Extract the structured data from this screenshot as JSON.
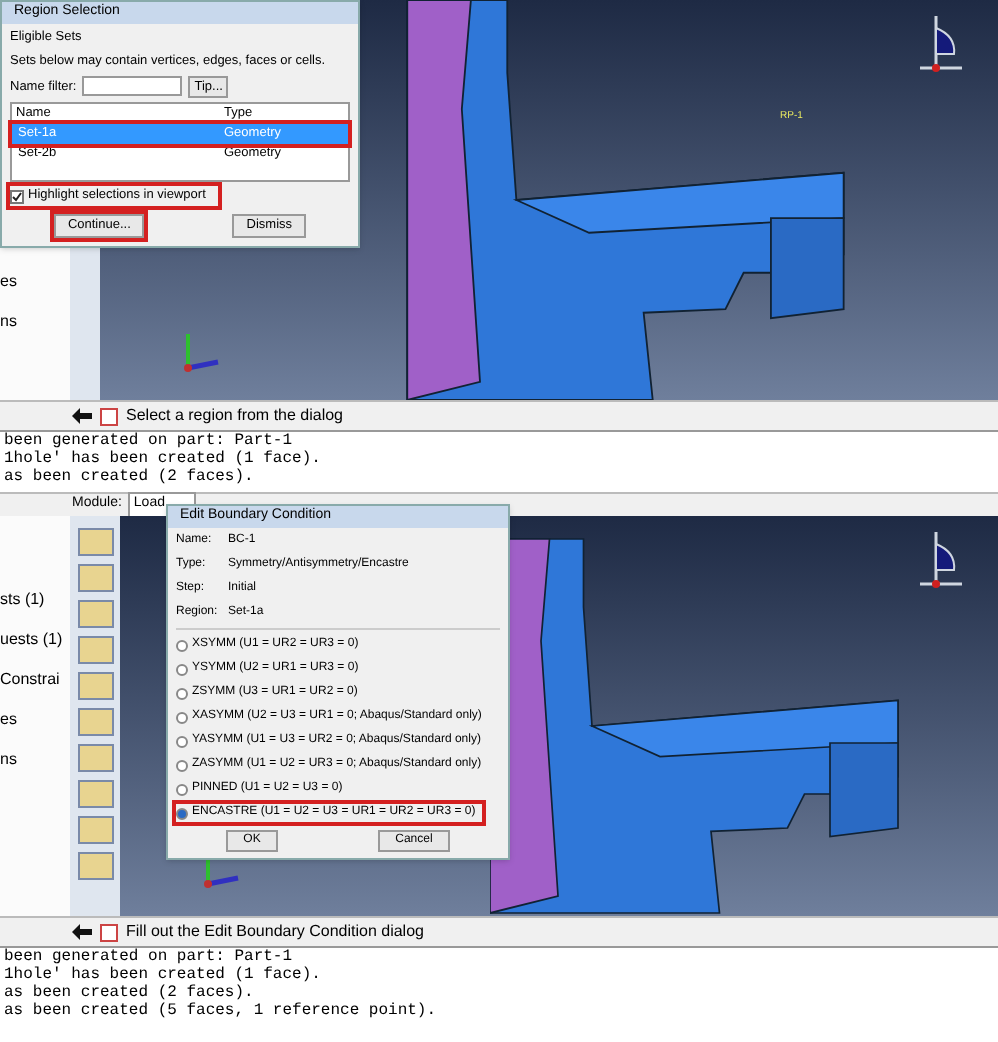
{
  "top_screen": {
    "tree_items": [
      "es",
      "ns"
    ],
    "region_dialog": {
      "title": "Region Selection",
      "section": "Eligible Sets",
      "description": "Sets below may contain vertices, edges, faces or cells.",
      "filter_label": "Name filter:",
      "tip_button": "Tip...",
      "columns": [
        "Name",
        "Type"
      ],
      "rows": [
        {
          "name": "Set-1a",
          "type": "Geometry",
          "selected": true,
          "highlighted": true
        },
        {
          "name": "Set-2b",
          "type": "Geometry",
          "selected": false,
          "highlighted": false
        }
      ],
      "highlight_checkbox": {
        "label": "Highlight selections in viewport",
        "checked": true,
        "highlighted": true
      },
      "buttons": [
        {
          "label": "Continue...",
          "highlighted": true
        },
        {
          "label": "Dismiss",
          "highlighted": false
        }
      ]
    },
    "rp_label": "RP-1",
    "prompt": "Select a region from the dialog",
    "messages": [
      "been generated on part: Part-1",
      "1hole' has been created (1 face).",
      "as been created (2 faces)."
    ]
  },
  "bottom_screen": {
    "module_label": "Module:",
    "module_value": "Load",
    "tree_items": [
      "sts (1)",
      "uests (1)",
      "Constrai",
      "es",
      "ns"
    ],
    "bc_dialog": {
      "title": "Edit Boundary Condition",
      "fields": [
        {
          "label": "Name:",
          "value": "BC-1"
        },
        {
          "label": "Type:",
          "value": "Symmetry/Antisymmetry/Encastre"
        },
        {
          "label": "Step:",
          "value": "Initial"
        },
        {
          "label": "Region:",
          "value": "Set-1a"
        }
      ],
      "options": [
        {
          "label": "XSYMM (U1 = UR2 = UR3 = 0)",
          "selected": false,
          "highlighted": false
        },
        {
          "label": "YSYMM (U2 = UR1 = UR3 = 0)",
          "selected": false,
          "highlighted": false
        },
        {
          "label": "ZSYMM (U3 = UR1 = UR2 = 0)",
          "selected": false,
          "highlighted": false
        },
        {
          "label": "XASYMM (U2 = U3 = UR1 = 0; Abaqus/Standard only)",
          "selected": false,
          "highlighted": false
        },
        {
          "label": "YASYMM (U1 = U3 = UR2 = 0; Abaqus/Standard only)",
          "selected": false,
          "highlighted": false
        },
        {
          "label": "ZASYMM (U1 = U2 = UR3 = 0; Abaqus/Standard only)",
          "selected": false,
          "highlighted": false
        },
        {
          "label": "PINNED (U1 = U2 = U3 = 0)",
          "selected": false,
          "highlighted": false
        },
        {
          "label": "ENCASTRE (U1 = U2 = U3 = UR1 = UR2 = UR3 = 0)",
          "selected": true,
          "highlighted": true
        }
      ],
      "buttons": [
        "OK",
        "Cancel"
      ]
    },
    "prompt": "Fill out the Edit Boundary Condition dialog",
    "messages": [
      "been generated on part: Part-1",
      "1hole' has been created (1 face).",
      "as been created (2 faces).",
      "as been created (5 faces, 1 reference point)."
    ]
  }
}
